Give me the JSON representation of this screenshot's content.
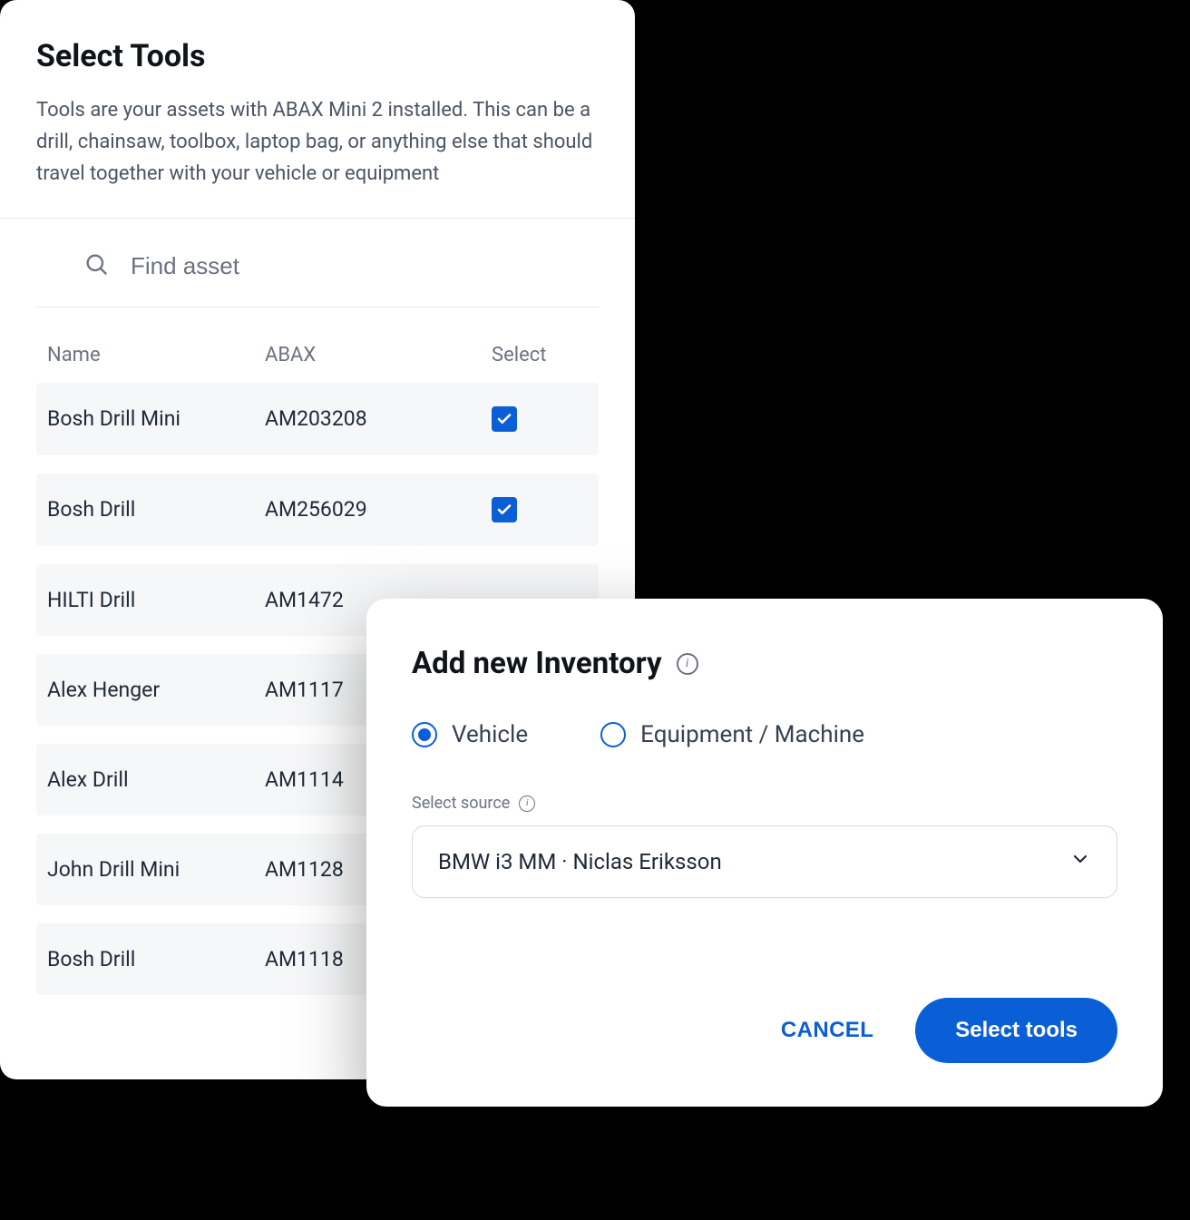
{
  "tools": {
    "title": "Select Tools",
    "description": "Tools are your assets with ABAX Mini 2 installed. This can be a drill, chainsaw, toolbox, laptop bag, or anything else that should travel together with your vehicle or equipment",
    "search_placeholder": "Find asset",
    "columns": {
      "name": "Name",
      "abax": "ABAX",
      "select": "Select"
    },
    "rows": [
      {
        "name": "Bosh Drill Mini",
        "abax": "AM203208",
        "checked": true
      },
      {
        "name": "Bosh Drill",
        "abax": "AM256029",
        "checked": true
      },
      {
        "name": "HILTI Drill",
        "abax": "AM1472",
        "checked": false
      },
      {
        "name": "Alex Henger",
        "abax": "AM1117",
        "checked": false
      },
      {
        "name": "Alex Drill",
        "abax": "AM1114",
        "checked": false
      },
      {
        "name": "John Drill Mini",
        "abax": "AM1128",
        "checked": false
      },
      {
        "name": "Bosh Drill",
        "abax": "AM1118",
        "checked": false
      }
    ]
  },
  "inventory": {
    "title": "Add new Inventory",
    "radio": {
      "vehicle": "Vehicle",
      "equipment": "Equipment / Machine",
      "selected": "vehicle"
    },
    "source_label": "Select source",
    "source_value": "BMW i3 MM · Niclas Eriksson",
    "cancel": "CANCEL",
    "primary": "Select tools"
  }
}
